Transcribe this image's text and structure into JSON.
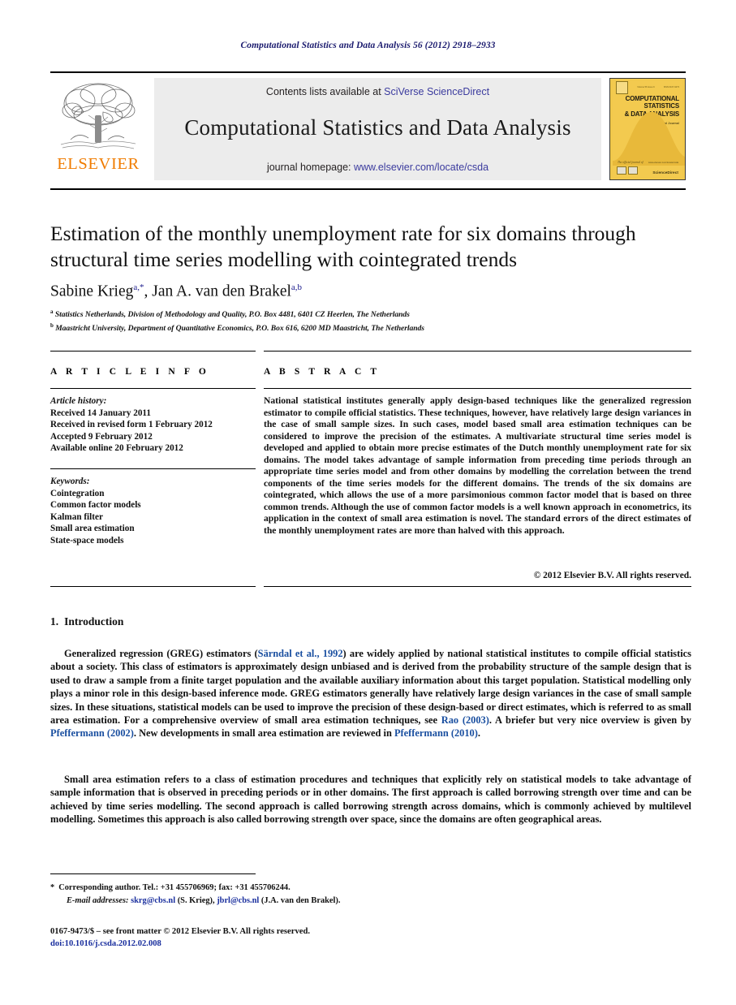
{
  "running_head": "Computational Statistics and Data Analysis 56 (2012) 2918–2933",
  "header": {
    "publisher": "ELSEVIER",
    "contents_prefix": "Contents lists available at ",
    "contents_link": "SciVerse ScienceDirect",
    "journal_name": "Computational Statistics and Data Analysis",
    "homepage_prefix": "journal homepage: ",
    "homepage_url": "www.elsevier.com/locate/csda",
    "cover": {
      "title_line1": "COMPUTATIONAL",
      "title_line2": "STATISTICS",
      "title_line3": "& DATA ANALYSIS",
      "subtitle": "An International Journal",
      "footer": "ScienceDirect",
      "volume_note": "Volume 56  Issue 9",
      "issn_note": "ISSN 0167-9473",
      "url_note": "www.elsevier.com/locate/csda",
      "quote": "The official journal of"
    }
  },
  "article": {
    "title": "Estimation of the monthly unemployment rate for six domains through structural time series modelling with cointegrated trends",
    "authors": [
      {
        "name": "Sabine Krieg",
        "marks": "a,*"
      },
      {
        "name": "Jan A. van den Brakel",
        "marks": "a,b"
      }
    ],
    "affiliations": [
      {
        "mark": "a",
        "text": "Statistics Netherlands, Division of Methodology and Quality, P.O. Box 4481, 6401 CZ Heerlen, The Netherlands"
      },
      {
        "mark": "b",
        "text": "Maastricht University, Department of Quantitative Economics, P.O. Box 616, 6200 MD Maastricht, The Netherlands"
      }
    ]
  },
  "info": {
    "heading": "A R T I C L E   I N F O",
    "history_label": "Article history:",
    "history": [
      "Received 14 January 2011",
      "Received in revised form 1 February 2012",
      "Accepted 9 February 2012",
      "Available online 20 February 2012"
    ],
    "keywords_label": "Keywords:",
    "keywords": [
      "Cointegration",
      "Common factor models",
      "Kalman filter",
      "Small area estimation",
      "State-space models"
    ]
  },
  "abstract": {
    "heading": "A B S T R A C T",
    "text": "National statistical institutes generally apply design-based techniques like the generalized regression estimator to compile official statistics. These techniques, however, have relatively large design variances in the case of small sample sizes. In such cases, model based small area estimation techniques can be considered to improve the precision of the estimates. A multivariate structural time series model is developed and applied to obtain more precise estimates of the Dutch monthly unemployment rate for six domains. The model takes advantage of sample information from preceding time periods through an appropriate time series model and from other domains by modelling the correlation between the trend components of the time series models for the different domains. The trends of the six domains are cointegrated, which allows the use of a more parsimonious common factor model that is based on three common trends. Although the use of common factor models is a well known approach in econometrics, its application in the context of small area estimation is novel. The standard errors of the direct estimates of the monthly unemployment rates are more than halved with this approach.",
    "copyright": "© 2012 Elsevier B.V. All rights reserved."
  },
  "introduction": {
    "number": "1.",
    "title": "Introduction",
    "paragraph_1": {
      "part1": "Generalized regression (GREG) estimators (",
      "cite1": "Särndal et al., 1992",
      "part2": ") are widely applied by national statistical institutes to compile official statistics about a society. This class of estimators is approximately design unbiased and is derived from the probability structure of the sample design that is used to draw a sample from a finite target population and the available auxiliary information about this target population. Statistical modelling only plays a minor role in this design-based inference mode. GREG estimators generally have relatively large design variances in the case of small sample sizes. In these situations, statistical models can be used to improve the precision of these design-based or direct estimates, which is referred to as small area estimation. For a comprehensive overview of small area estimation techniques, see ",
      "cite2": "Rao (2003)",
      "part3": ". A briefer but very nice overview is given by ",
      "cite3": "Pfeffermann (2002)",
      "part4": ". New developments in small area estimation are reviewed in ",
      "cite4": "Pfeffermann (2010)",
      "part5": "."
    },
    "paragraph_2": "Small area estimation refers to a class of estimation procedures and techniques that explicitly rely on statistical models to take advantage of sample information that is observed in preceding periods or in other domains. The first approach is called borrowing strength over time and can be achieved by time series modelling. The second approach is called borrowing strength across domains, which is commonly achieved by multilevel modelling. Sometimes this approach is also called borrowing strength over space, since the domains are often geographical areas."
  },
  "footnotes": {
    "corresponding": "Corresponding author. Tel.: +31 455706969; fax: +31 455706244.",
    "email_label": "E-mail addresses:",
    "email_1": "skrg@cbs.nl",
    "email_1_owner": "(S. Krieg),",
    "email_2": "jbrl@cbs.nl",
    "email_2_owner": "(J.A. van den Brakel)."
  },
  "imprint": {
    "line1": "0167-9473/$ – see front matter © 2012 Elsevier B.V. All rights reserved.",
    "doi": "doi:10.1016/j.csda.2012.02.008"
  }
}
